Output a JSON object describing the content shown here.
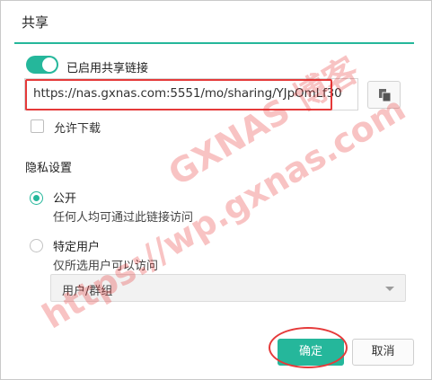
{
  "dialog": {
    "title": "共享",
    "toggle_label": "已启用共享链接",
    "share_link": "https://nas.gxnas.com:5551/mo/sharing/YJpOmLf30",
    "allow_download_label": "允许下载",
    "privacy_section_title": "隐私设置",
    "options": [
      {
        "title": "公开",
        "desc": "任何人均可通过此链接访问",
        "checked": true
      },
      {
        "title": "特定用户",
        "desc": "仅所选用户可以访问",
        "checked": false
      }
    ],
    "user_group_select": "用户/群组",
    "ok_label": "确定",
    "cancel_label": "取消",
    "toggle_enabled": true,
    "allow_download_checked": false
  },
  "watermark": {
    "line1": "GXNAS 博客",
    "line2": "https://wp.gxnas.com"
  },
  "colors": {
    "accent": "#25b79b",
    "highlight": "#e53a3a"
  },
  "icons": {
    "copy": "copy-icon",
    "dropdown": "chevron-down-icon"
  }
}
